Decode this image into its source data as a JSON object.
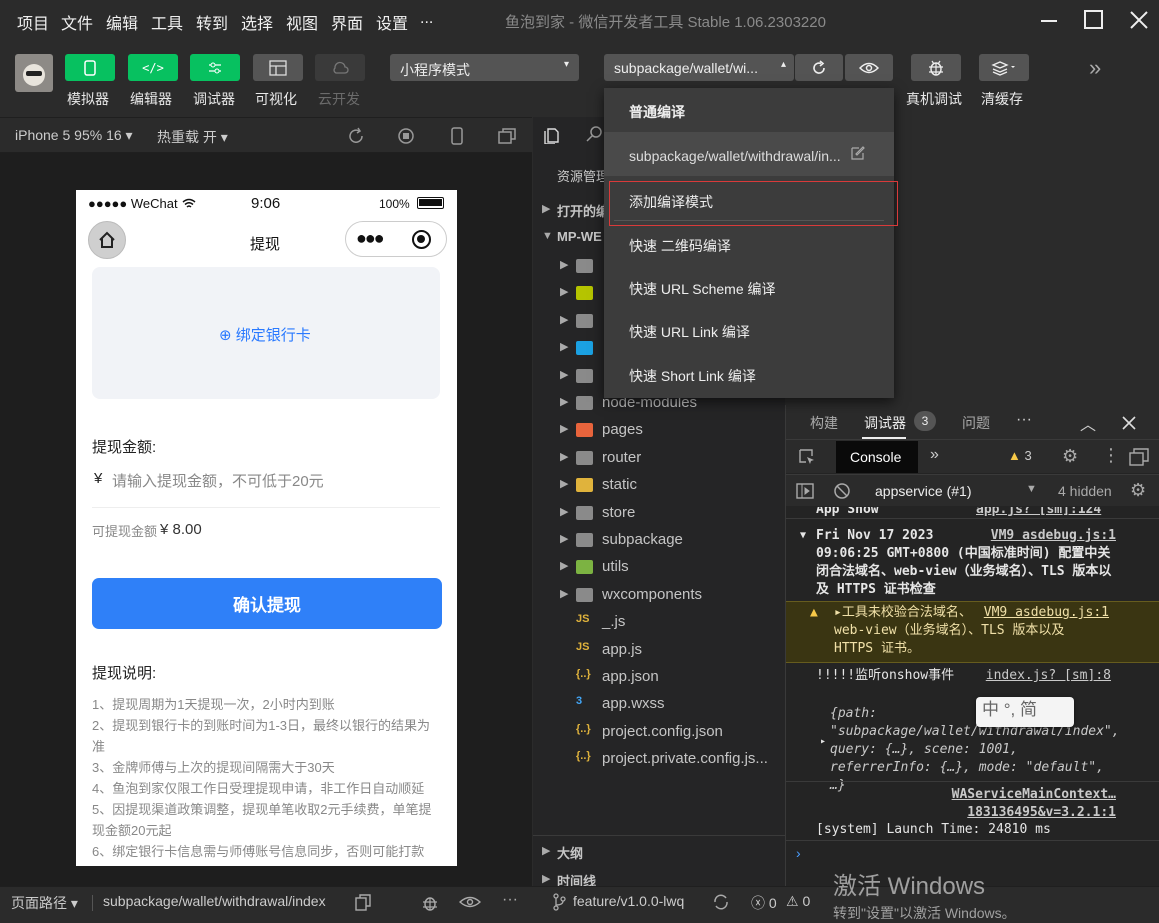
{
  "menubar": {
    "items": [
      "项目",
      "文件",
      "编辑",
      "工具",
      "转到",
      "选择",
      "视图",
      "界面",
      "设置",
      "..."
    ],
    "window_title": "鱼泡到家 - 微信开发者工具 Stable 1.06.2303220"
  },
  "toolbar": {
    "simulator_label": "模拟器",
    "editor_label": "编辑器",
    "debugger_label": "调试器",
    "visual_label": "可视化",
    "cloud_label": "云开发",
    "mode_select": "小程序模式",
    "compile_select": "subpackage/wallet/wi...",
    "real_debug_label": "真机调试",
    "clear_cache_label": "清缓存",
    "accent_color": "#07c160"
  },
  "compile_dropdown": {
    "items": [
      "普通编译",
      "subpackage/wallet/withdrawal/in...",
      "添加编译模式",
      "快速 二维码编译",
      "快速 URL Scheme 编译",
      "快速 URL Link 编译",
      "快速 Short Link 编译"
    ]
  },
  "sim_bar": {
    "device": "iPhone 5 95% 16",
    "hot_reload": "热重载 开"
  },
  "phone": {
    "signal": "●●●●● WeChat",
    "time": "9:06",
    "battery": "100%",
    "nav_title": "提现",
    "bind_card": "绑定银行卡",
    "amount_label": "提现金额:",
    "currency": "¥",
    "amount_placeholder": "请输入提现金额，不可低于20元",
    "available_label": "可提现金额",
    "available_value": "¥ 8.00",
    "confirm_button": "确认提现",
    "notes_title": "提现说明:",
    "notes": [
      "1、提现周期为1天提现一次，2小时内到账",
      "2、提现到银行卡的到账时间为1-3日，最终以银行的结果为准",
      "3、金牌师傅与上次的提现间隔需大于30天",
      "4、鱼泡到家仅限工作日受理提现申请，非工作日自动顺延",
      "5、因提现渠道政策调整，提现单笔收取2元手续费，单笔提现金额20元起",
      "6、绑定银行卡信息需与师傅账号信息同步，否则可能打款"
    ]
  },
  "explorer": {
    "header": "资源管理",
    "open_editors": "打开的编",
    "project": "MP-WE",
    "rows": [
      {
        "name": "",
        "color": "#8a8a8a",
        "chev": true
      },
      {
        "name": "",
        "color": "#b5c400",
        "chev": true
      },
      {
        "name": "",
        "color": "#8a8a8a",
        "chev": true
      },
      {
        "name": "",
        "color": "#1ba1e2",
        "chev": true
      },
      {
        "name": "",
        "color": "#8a8a8a",
        "chev": true
      },
      {
        "name": "node-modules",
        "color": "#8a8a8a",
        "chev": true
      },
      {
        "name": "pages",
        "color": "#e8643c",
        "chev": true
      },
      {
        "name": "router",
        "color": "#8a8a8a",
        "chev": true
      },
      {
        "name": "static",
        "color": "#e0b33c",
        "chev": true
      },
      {
        "name": "store",
        "color": "#8a8a8a",
        "chev": true
      },
      {
        "name": "subpackage",
        "color": "#8a8a8a",
        "chev": true
      },
      {
        "name": "utils",
        "color": "#7cb342",
        "chev": true
      },
      {
        "name": "wxcomponents",
        "color": "#8a8a8a",
        "chev": true
      },
      {
        "name": "_.js",
        "color": "#e0b33c",
        "chev": false,
        "tag": "JS"
      },
      {
        "name": "app.js",
        "color": "#e0b33c",
        "chev": false,
        "tag": "JS"
      },
      {
        "name": "app.json",
        "color": "#e0b33c",
        "chev": false,
        "tag": "{..}"
      },
      {
        "name": "app.wxss",
        "color": "#42a5f5",
        "chev": false,
        "tag": "3"
      },
      {
        "name": "project.config.json",
        "color": "#e0b33c",
        "chev": false,
        "tag": "{..}"
      },
      {
        "name": "project.private.config.js...",
        "color": "#e0b33c",
        "chev": false,
        "tag": "{..}"
      }
    ],
    "outline": "大纲",
    "timeline": "时间线"
  },
  "devtools": {
    "tabs": [
      "构建",
      "调试器",
      "问题"
    ],
    "debugger_badge": "3",
    "console_tab": "Console",
    "warn_count": "3",
    "context": "appservice (#1)",
    "hidden": "4 hidden",
    "lines": {
      "app_show": "App Show",
      "app_show_src": "app.js? [sm]:124",
      "date_text": "Fri Nov 17 2023 09:06:25 GMT+0800 (中国标准时间) 配置中关闭合法域名、web-view（业务域名）、TLS 版本以及 HTTPS 证书检查",
      "date_src": "VM9 asdebug.js:1",
      "warn_text": "工具未校验合法域名、web-view（业务域名）、TLS 版本以及 HTTPS 证书。",
      "warn_src": "VM9 asdebug.js:1",
      "onshow_text": "!!!!!监听onshow事件",
      "onshow_src": "index.js? [sm]:8",
      "obj_text": "{path: \"subpackage/wallet/withdrawal/index\", query: {…}, scene: 1001, referrerInfo: {…}, mode: \"default\", …}",
      "wa_src": "WAServiceMainContext…183136495&v=3.2.1:1",
      "launch": "[system] Launch Time: 24810 ms"
    },
    "ime": "中 °, 简"
  },
  "statusbar": {
    "path_label": "页面路径",
    "path": "subpackage/wallet/withdrawal/index",
    "branch": "feature/v1.0.0-lwq",
    "errors": "0",
    "warnings": "0"
  },
  "watermark": {
    "line1": "激活 Windows",
    "line2": "转到\"设置\"以激活 Windows。"
  }
}
